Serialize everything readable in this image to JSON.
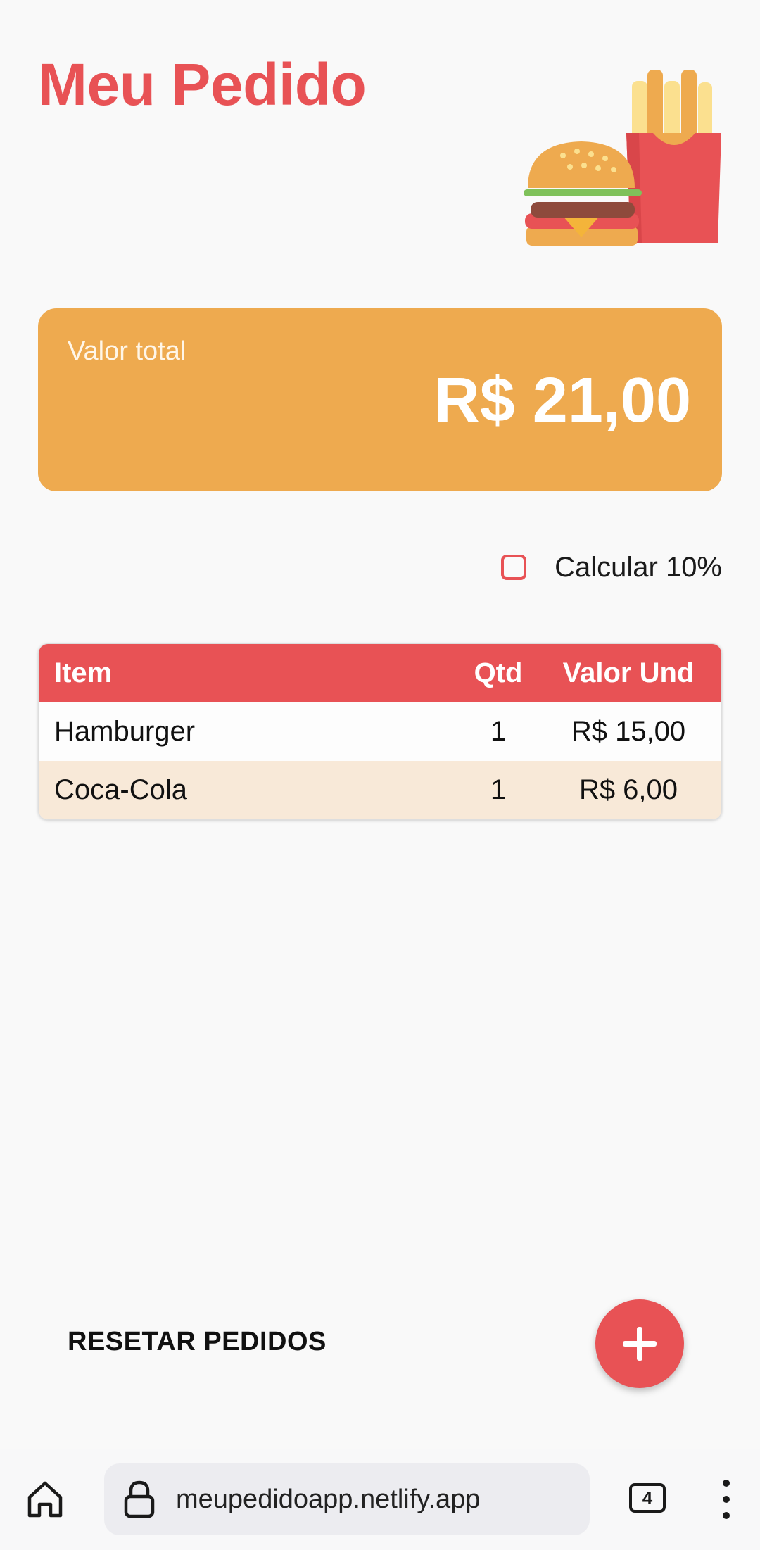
{
  "app": {
    "title": "Meu Pedido",
    "illustration": "burger-and-fries-illustration"
  },
  "total": {
    "label": "Valor total",
    "value": "R$ 21,00"
  },
  "tip": {
    "label": "Calcular 10%",
    "checked": false
  },
  "table": {
    "headers": {
      "item": "Item",
      "qtd": "Qtd",
      "valor": "Valor Und"
    },
    "rows": [
      {
        "item": "Hamburger",
        "qtd": "1",
        "valor": "R$ 15,00"
      },
      {
        "item": "Coca-Cola",
        "qtd": "1",
        "valor": "R$ 6,00"
      }
    ]
  },
  "actions": {
    "reset_label": "RESETAR PEDIDOS",
    "add_icon": "plus-icon"
  },
  "browser": {
    "url": "meupedidoapp.netlify.app",
    "tab_count": "4",
    "home_icon": "home-icon",
    "lock_icon": "lock-icon",
    "menu_icon": "more-vertical-icon"
  },
  "colors": {
    "brand_red": "#e85255",
    "total_orange": "#eeaa4f",
    "row_alt": "#f8e9d8"
  }
}
